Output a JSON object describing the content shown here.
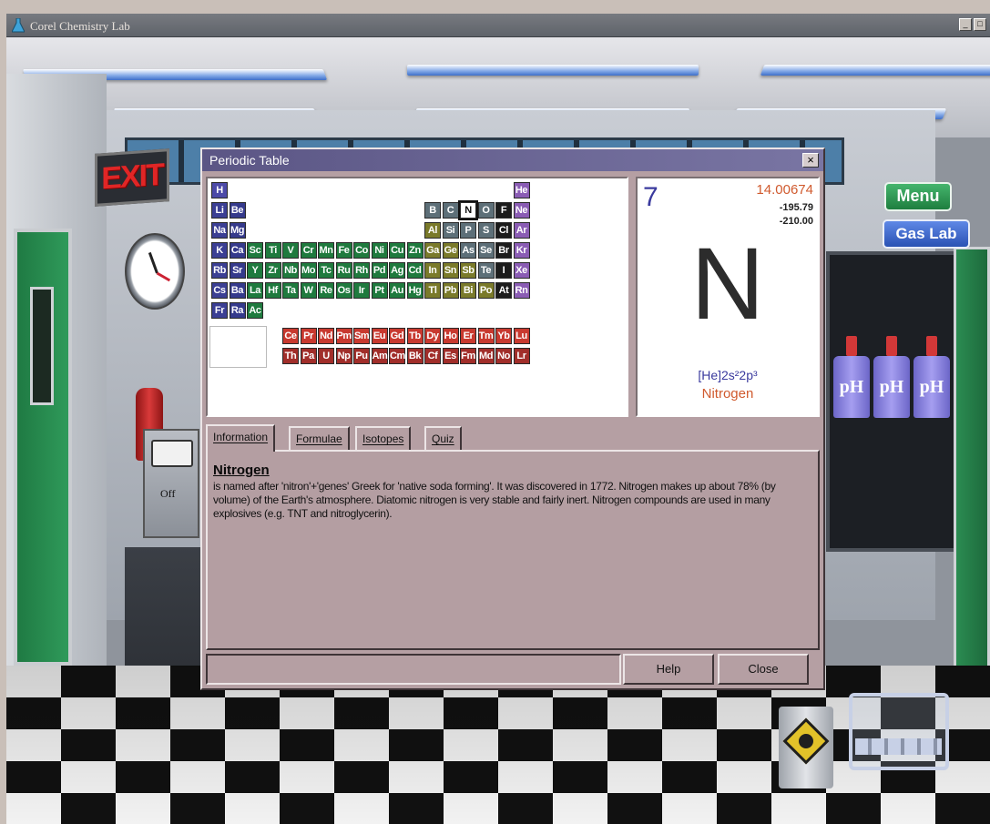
{
  "app": {
    "title": "Corel Chemistry Lab",
    "minimize_glyph": "_",
    "maximize_glyph": "□"
  },
  "scene": {
    "exit_sign": "EXIT",
    "meter_label": "Off",
    "menu_button": "Menu",
    "gaslab_button": "Gas Lab",
    "bottle_labels": [
      "pH",
      "pH",
      "pH"
    ],
    "colors": {
      "menu": "#2a9150",
      "gaslab": "#3c63c6",
      "exit": "#e02626"
    }
  },
  "dialog": {
    "title": "Periodic Table",
    "close_glyph": "×",
    "element_card": {
      "number": "7",
      "mass": "14.00674",
      "boiling_point": "-195.79",
      "melting_point": "-210.00",
      "symbol": "N",
      "config": "[He]2s²2p³",
      "name": "Nitrogen"
    },
    "tabs": [
      "Information",
      "Formulae",
      "Isotopes",
      "Quiz"
    ],
    "info": {
      "title": "Nitrogen",
      "body": "is named after 'nitron'+'genes' Greek for 'native soda forming'. It was discovered in 1772. Nitrogen makes up about 78% (by volume) of the Earth's atmosphere. Diatomic nitrogen is very stable and fairly inert. Nitrogen compounds are used in many explosives (e.g. TNT and nitroglycerin)."
    },
    "buttons": {
      "help": "Help",
      "close": "Close"
    },
    "selected_element": "N"
  },
  "periodic_table": {
    "rows": [
      [
        [
          "H",
          1,
          "g-h"
        ],
        [
          "He",
          18,
          "g-noble"
        ]
      ],
      [
        [
          "Li",
          1,
          "g-alk"
        ],
        [
          "Be",
          2,
          "g-alkE"
        ],
        [
          "B",
          13,
          "g-met"
        ],
        [
          "C",
          14,
          "g-met"
        ],
        [
          "N",
          15,
          "g-sel"
        ],
        [
          "O",
          16,
          "g-met"
        ],
        [
          "F",
          17,
          "g-hal"
        ],
        [
          "Ne",
          18,
          "g-noble"
        ]
      ],
      [
        [
          "Na",
          1,
          "g-alk"
        ],
        [
          "Mg",
          2,
          "g-alkE"
        ],
        [
          "Al",
          13,
          "g-post"
        ],
        [
          "Si",
          14,
          "g-met"
        ],
        [
          "P",
          15,
          "g-met"
        ],
        [
          "S",
          16,
          "g-met"
        ],
        [
          "Cl",
          17,
          "g-hal"
        ],
        [
          "Ar",
          18,
          "g-noble"
        ]
      ],
      [
        [
          "K",
          1,
          "g-alk"
        ],
        [
          "Ca",
          2,
          "g-alkE"
        ],
        [
          "Sc",
          3,
          "g-tm"
        ],
        [
          "Ti",
          4,
          "g-tm"
        ],
        [
          "V",
          5,
          "g-tm"
        ],
        [
          "Cr",
          6,
          "g-tm"
        ],
        [
          "Mn",
          7,
          "g-tm"
        ],
        [
          "Fe",
          8,
          "g-tm"
        ],
        [
          "Co",
          9,
          "g-tm"
        ],
        [
          "Ni",
          10,
          "g-tm"
        ],
        [
          "Cu",
          11,
          "g-tm"
        ],
        [
          "Zn",
          12,
          "g-tm"
        ],
        [
          "Ga",
          13,
          "g-post"
        ],
        [
          "Ge",
          14,
          "g-post"
        ],
        [
          "As",
          15,
          "g-met"
        ],
        [
          "Se",
          16,
          "g-met"
        ],
        [
          "Br",
          17,
          "g-hal"
        ],
        [
          "Kr",
          18,
          "g-noble"
        ]
      ],
      [
        [
          "Rb",
          1,
          "g-alk"
        ],
        [
          "Sr",
          2,
          "g-alkE"
        ],
        [
          "Y",
          3,
          "g-tm"
        ],
        [
          "Zr",
          4,
          "g-tm"
        ],
        [
          "Nb",
          5,
          "g-tm"
        ],
        [
          "Mo",
          6,
          "g-tm"
        ],
        [
          "Tc",
          7,
          "g-tm"
        ],
        [
          "Ru",
          8,
          "g-tm"
        ],
        [
          "Rh",
          9,
          "g-tm"
        ],
        [
          "Pd",
          10,
          "g-tm"
        ],
        [
          "Ag",
          11,
          "g-tm"
        ],
        [
          "Cd",
          12,
          "g-tm"
        ],
        [
          "In",
          13,
          "g-post"
        ],
        [
          "Sn",
          14,
          "g-post"
        ],
        [
          "Sb",
          15,
          "g-post"
        ],
        [
          "Te",
          16,
          "g-met"
        ],
        [
          "I",
          17,
          "g-hal"
        ],
        [
          "Xe",
          18,
          "g-noble"
        ]
      ],
      [
        [
          "Cs",
          1,
          "g-alk"
        ],
        [
          "Ba",
          2,
          "g-alkE"
        ],
        [
          "La",
          3,
          "g-tm"
        ],
        [
          "Hf",
          4,
          "g-tm"
        ],
        [
          "Ta",
          5,
          "g-tm"
        ],
        [
          "W",
          6,
          "g-tm"
        ],
        [
          "Re",
          7,
          "g-tm"
        ],
        [
          "Os",
          8,
          "g-tm"
        ],
        [
          "Ir",
          9,
          "g-tm"
        ],
        [
          "Pt",
          10,
          "g-tm"
        ],
        [
          "Au",
          11,
          "g-tm"
        ],
        [
          "Hg",
          12,
          "g-tm"
        ],
        [
          "Tl",
          13,
          "g-post"
        ],
        [
          "Pb",
          14,
          "g-post"
        ],
        [
          "Bi",
          15,
          "g-post"
        ],
        [
          "Po",
          16,
          "g-post"
        ],
        [
          "At",
          17,
          "g-hal"
        ],
        [
          "Rn",
          18,
          "g-noble"
        ]
      ],
      [
        [
          "Fr",
          1,
          "g-alk"
        ],
        [
          "Ra",
          2,
          "g-alkE"
        ],
        [
          "Ac",
          3,
          "g-tm"
        ]
      ]
    ],
    "lanthanides": [
      "Ce",
      "Pr",
      "Nd",
      "Pm",
      "Sm",
      "Eu",
      "Gd",
      "Tb",
      "Dy",
      "Ho",
      "Er",
      "Tm",
      "Yb",
      "Lu"
    ],
    "actinides": [
      "Th",
      "Pa",
      "U",
      "Np",
      "Pu",
      "Am",
      "Cm",
      "Bk",
      "Cf",
      "Es",
      "Fm",
      "Md",
      "No",
      "Lr"
    ]
  }
}
